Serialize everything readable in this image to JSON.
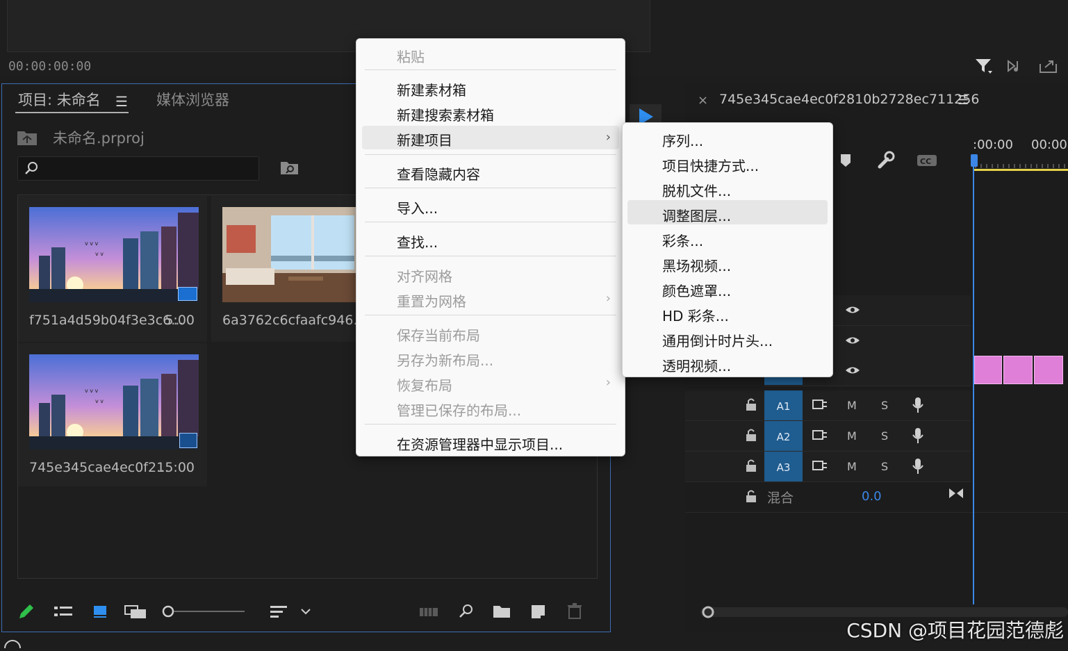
{
  "top": {
    "timecode": "00:00:00:00"
  },
  "project_panel": {
    "tabs": [
      {
        "label": "项目: 未命名"
      },
      {
        "label": "媒体浏览器"
      }
    ],
    "project_file": "未命名.prproj",
    "search": {
      "value": "",
      "placeholder": ""
    },
    "clips": [
      {
        "name": "f751a4d59b04f3e3c6...",
        "duration": "5:00"
      },
      {
        "name": "6a3762c6cfaafc946...",
        "duration": ""
      },
      {
        "name": "745e345cae4ec0f2...",
        "duration": "15:00"
      }
    ]
  },
  "context_menu": {
    "items": [
      {
        "label": "粘贴",
        "disabled": true
      },
      {
        "label": "新建素材箱",
        "disabled": false
      },
      {
        "label": "新建搜索素材箱",
        "disabled": false
      },
      {
        "label": "新建项目",
        "disabled": false,
        "submenu": true
      },
      {
        "label": "查看隐藏内容",
        "disabled": false
      },
      {
        "label": "导入...",
        "disabled": false
      },
      {
        "label": "查找...",
        "disabled": false
      },
      {
        "label": "对齐网格",
        "disabled": true
      },
      {
        "label": "重置为网格",
        "disabled": true,
        "submenu": true
      },
      {
        "label": "保存当前布局",
        "disabled": true
      },
      {
        "label": "另存为新布局...",
        "disabled": true
      },
      {
        "label": "恢复布局",
        "disabled": true,
        "submenu": true
      },
      {
        "label": "管理已保存的布局...",
        "disabled": true
      },
      {
        "label": "在资源管理器中显示项目...",
        "disabled": false
      }
    ]
  },
  "submenu": {
    "items": [
      {
        "label": "序列..."
      },
      {
        "label": "项目快捷方式..."
      },
      {
        "label": "脱机文件..."
      },
      {
        "label": "调整图层..."
      },
      {
        "label": "彩条..."
      },
      {
        "label": "黑场视频..."
      },
      {
        "label": "颜色遮罩..."
      },
      {
        "label": "HD 彩条..."
      },
      {
        "label": "通用倒计时片头..."
      },
      {
        "label": "透明视频..."
      }
    ],
    "hovered": "调整图层..."
  },
  "timeline": {
    "sequence_name": "745e345cae4ec0f2810b2728ec711256",
    "ruler": [
      ":00:00",
      "00:00:"
    ],
    "audio_tracks": [
      {
        "label": "A1",
        "m": "M",
        "s": "S"
      },
      {
        "label": "A2",
        "m": "M",
        "s": "S"
      },
      {
        "label": "A3",
        "m": "M",
        "s": "S"
      }
    ],
    "mix_label": "混合",
    "mix_value": "0.0"
  },
  "watermark": "CSDN @项目花园范德彪",
  "colors": {
    "accent": "#3b86e6",
    "track_label": "#1f5c8f",
    "clip_pink": "#e07fd8"
  }
}
